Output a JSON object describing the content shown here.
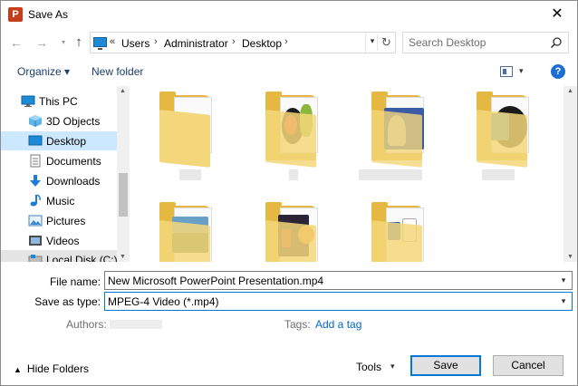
{
  "window": {
    "title": "Save As",
    "close_glyph": "✕"
  },
  "nav": {
    "back_glyph": "←",
    "forward_glyph": "→",
    "recent_glyph": "▾",
    "up_glyph": "↑",
    "address_prefix": "«",
    "breadcrumbs": [
      "Users",
      "Administrator",
      "Desktop"
    ],
    "separator": "›",
    "dropdown_glyph": "▾",
    "refresh_glyph": "↻",
    "search_placeholder": "Search Desktop"
  },
  "toolbar": {
    "organize_label": "Organize ▾",
    "new_folder_label": "New folder",
    "view_dropdown_glyph": "▾",
    "help_glyph": "?"
  },
  "sidebar": {
    "items": [
      {
        "label": "This PC",
        "icon": "this-pc-icon"
      },
      {
        "label": "3D Objects",
        "icon": "3d-objects-icon"
      },
      {
        "label": "Desktop",
        "icon": "desktop-icon"
      },
      {
        "label": "Documents",
        "icon": "documents-icon"
      },
      {
        "label": "Downloads",
        "icon": "downloads-icon"
      },
      {
        "label": "Music",
        "icon": "music-icon"
      },
      {
        "label": "Pictures",
        "icon": "pictures-icon"
      },
      {
        "label": "Videos",
        "icon": "videos-icon"
      },
      {
        "label": "Local Disk (C:)",
        "icon": "local-disk-icon"
      }
    ],
    "scroll_up_glyph": "▲",
    "scroll_down_glyph": "▼"
  },
  "content": {
    "scroll_up_glyph": "▲",
    "scroll_down_glyph": "▼"
  },
  "form": {
    "file_name_label": "File name:",
    "file_name_value": "New Microsoft PowerPoint Presentation.mp4",
    "save_type_label": "Save as type:",
    "save_type_value": "MPEG-4 Video (*.mp4)",
    "dropdown_glyph": "▾",
    "authors_label": "Authors:",
    "tags_label": "Tags:",
    "add_tag_label": "Add a tag"
  },
  "footer": {
    "hide_folders_caret": "▲",
    "hide_folders_label": "Hide Folders",
    "tools_label": "Tools",
    "tools_dropdown_glyph": "▾",
    "save_label": "Save",
    "cancel_label": "Cancel"
  },
  "colors": {
    "accent": "#0078d7",
    "folder": "#e5b842",
    "selection": "#cce8ff",
    "link": "#0066cc"
  }
}
